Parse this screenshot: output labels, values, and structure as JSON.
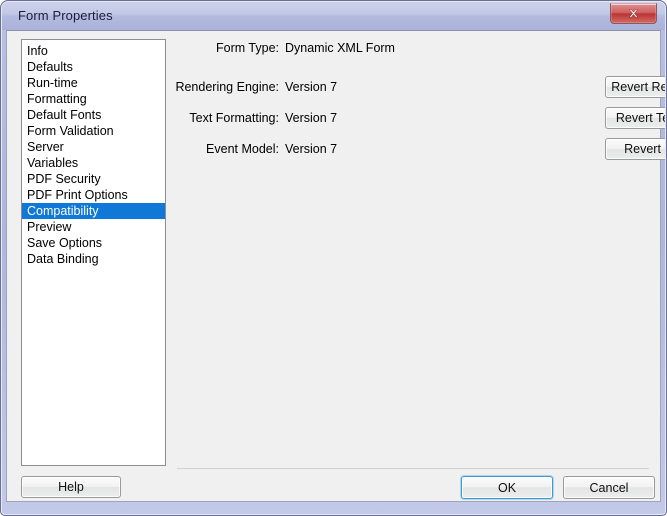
{
  "window": {
    "title": "Form Properties",
    "title_watermark": "",
    "close_icon": "close-icon",
    "accent_title_color": "#b2bae0",
    "close_button_color": "#c05050"
  },
  "sidebar": {
    "selected_index": 10,
    "items": [
      {
        "label": "Info"
      },
      {
        "label": "Defaults"
      },
      {
        "label": "Run-time"
      },
      {
        "label": "Formatting"
      },
      {
        "label": "Default Fonts"
      },
      {
        "label": "Form Validation"
      },
      {
        "label": "Server"
      },
      {
        "label": "Variables"
      },
      {
        "label": "PDF Security"
      },
      {
        "label": "PDF Print Options"
      },
      {
        "label": "Compatibility"
      },
      {
        "label": "Preview"
      },
      {
        "label": "Save Options"
      },
      {
        "label": "Data Binding"
      }
    ],
    "selection_color": "#1078d7"
  },
  "main": {
    "form_type": {
      "label": "Form Type:",
      "value": "Dynamic XML Form"
    },
    "rows": [
      {
        "label": "Rendering Engine:",
        "value": "Version 7",
        "button": "Revert Rendering Model"
      },
      {
        "label": "Text Formatting:",
        "value": "Version 7",
        "button": "Revert Text Formatting"
      },
      {
        "label": "Event Model:",
        "value": "Version 7",
        "button": "Revert Event Model"
      }
    ]
  },
  "footer": {
    "help_label": "Help",
    "ok_label": "OK",
    "cancel_label": "Cancel",
    "default_button": "OK",
    "default_focus_color": "#3d9ad4"
  }
}
